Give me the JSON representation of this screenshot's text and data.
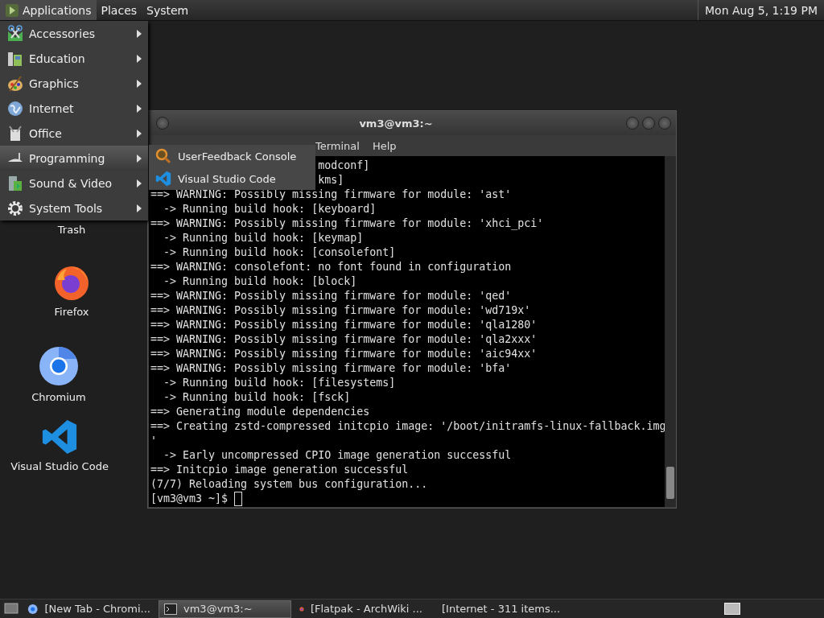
{
  "top_panel": {
    "menus": [
      {
        "label": "Applications",
        "selected": true
      },
      {
        "label": "Places",
        "selected": false
      },
      {
        "label": "System",
        "selected": false
      }
    ],
    "clock": "Mon Aug 5, 1:19 PM"
  },
  "desktop_icons": [
    {
      "label": "Trash"
    },
    {
      "label": "Firefox"
    },
    {
      "label": "Chromium"
    },
    {
      "label": "Visual Studio Code"
    }
  ],
  "terminal": {
    "title": "vm3@vm3:~",
    "menus": [
      "Terminal",
      "Help"
    ],
    "lines": [
      {
        "kind": "covered",
        "text": "modconf]"
      },
      {
        "kind": "covered",
        "text": "kms]"
      },
      {
        "kind": "full",
        "text": "==> WARNING: Possibly missing firmware for module: 'ast'"
      },
      {
        "kind": "full",
        "text": "  -> Running build hook: [keyboard]"
      },
      {
        "kind": "full",
        "text": "==> WARNING: Possibly missing firmware for module: 'xhci_pci'"
      },
      {
        "kind": "full",
        "text": "  -> Running build hook: [keymap]"
      },
      {
        "kind": "full",
        "text": "  -> Running build hook: [consolefont]"
      },
      {
        "kind": "full",
        "text": "==> WARNING: consolefont: no font found in configuration"
      },
      {
        "kind": "full",
        "text": "  -> Running build hook: [block]"
      },
      {
        "kind": "full",
        "text": "==> WARNING: Possibly missing firmware for module: 'qed'"
      },
      {
        "kind": "full",
        "text": "==> WARNING: Possibly missing firmware for module: 'wd719x'"
      },
      {
        "kind": "full",
        "text": "==> WARNING: Possibly missing firmware for module: 'qla1280'"
      },
      {
        "kind": "full",
        "text": "==> WARNING: Possibly missing firmware for module: 'qla2xxx'"
      },
      {
        "kind": "full",
        "text": "==> WARNING: Possibly missing firmware for module: 'aic94xx'"
      },
      {
        "kind": "full",
        "text": "==> WARNING: Possibly missing firmware for module: 'bfa'"
      },
      {
        "kind": "full",
        "text": "  -> Running build hook: [filesystems]"
      },
      {
        "kind": "full",
        "text": "  -> Running build hook: [fsck]"
      },
      {
        "kind": "full",
        "text": "==> Generating module dependencies"
      },
      {
        "kind": "full",
        "text": "==> Creating zstd-compressed initcpio image: '/boot/initramfs-linux-fallback.img"
      },
      {
        "kind": "full",
        "text": "'"
      },
      {
        "kind": "full",
        "text": "  -> Early uncompressed CPIO image generation successful"
      },
      {
        "kind": "full",
        "text": "==> Initcpio image generation successful"
      },
      {
        "kind": "full",
        "text": "(7/7) Reloading system bus configuration..."
      }
    ],
    "prompt": "[vm3@vm3 ~]$"
  },
  "applications_menu": {
    "items": [
      {
        "label": "Accessories",
        "selected": false
      },
      {
        "label": "Education",
        "selected": false
      },
      {
        "label": "Graphics",
        "selected": false
      },
      {
        "label": "Internet",
        "selected": false
      },
      {
        "label": "Office",
        "selected": false
      },
      {
        "label": "Programming",
        "selected": true
      },
      {
        "label": "Sound & Video",
        "selected": false
      },
      {
        "label": "System Tools",
        "selected": false
      }
    ]
  },
  "programming_submenu": {
    "items": [
      {
        "label": "UserFeedback Console"
      },
      {
        "label": "Visual Studio Code"
      }
    ]
  },
  "taskbar": {
    "tasks": [
      {
        "label": "[New Tab - Chromi...",
        "selected": false
      },
      {
        "label": "vm3@vm3:~",
        "selected": true
      },
      {
        "label": "[Flatpak - ArchWiki ...",
        "selected": false
      },
      {
        "label": "[Internet - 311 items...",
        "selected": false
      }
    ]
  }
}
